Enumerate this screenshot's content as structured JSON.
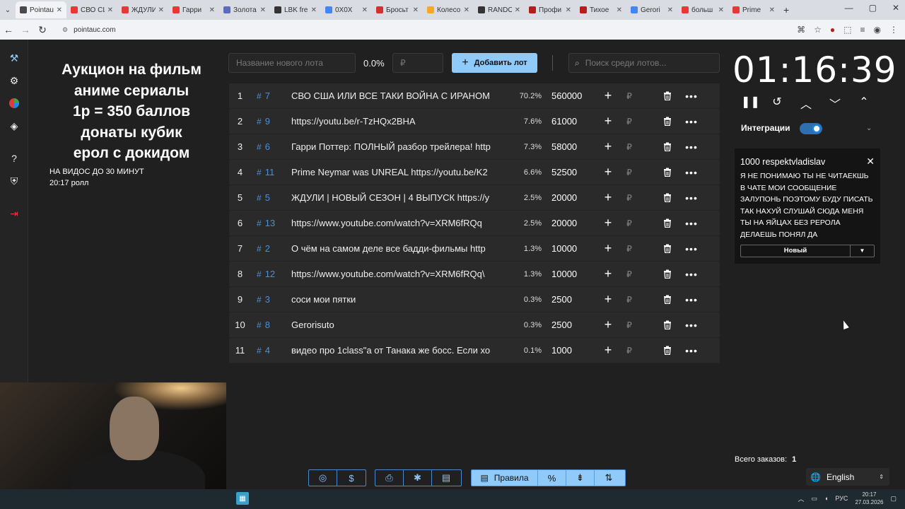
{
  "browser": {
    "tabs": [
      {
        "label": "Pointauc",
        "color": "#4a4a4a",
        "active": true
      },
      {
        "label": "СВО США",
        "color": "#e53935",
        "active": false
      },
      {
        "label": "ЖДУЛИ",
        "color": "#e53935",
        "active": false
      },
      {
        "label": "Гарри",
        "color": "#e53935",
        "active": false
      },
      {
        "label": "Золота",
        "color": "#5c6bc0",
        "active": false
      },
      {
        "label": "LBK fre",
        "color": "#333333",
        "active": false
      },
      {
        "label": "0Х0Х",
        "color": "#4285f4",
        "active": false
      },
      {
        "label": "Бросьт",
        "color": "#d32f2f",
        "active": false
      },
      {
        "label": "Колесо",
        "color": "#f9a825",
        "active": false
      },
      {
        "label": "RANDO",
        "color": "#333333",
        "active": false
      },
      {
        "label": "Профи",
        "color": "#b71c1c",
        "active": false
      },
      {
        "label": "Тихое",
        "color": "#b71c1c",
        "active": false
      },
      {
        "label": "Gerori",
        "color": "#4285f4",
        "active": false
      },
      {
        "label": "больш",
        "color": "#e53935",
        "active": false
      },
      {
        "label": "Prime",
        "color": "#e53935",
        "active": false
      }
    ],
    "url": "pointauc.com"
  },
  "sidebar": {
    "icons": [
      "hammer-icon",
      "gear-icon",
      "wheel-icon",
      "layers-icon",
      "help-icon",
      "shield-icon",
      "logout-icon"
    ]
  },
  "header": {
    "title_lines": [
      "Аукцион на фильм",
      "аниме сериалы",
      "1р = 350 баллов",
      "донаты кубик",
      "ерол с докидом"
    ],
    "note1": "НА ВИДОС ДО 30 МИНУТ",
    "note2": "20:17 ролл"
  },
  "controls": {
    "lot_name_placeholder": "Название нового лота",
    "percent": "0.0%",
    "amount_placeholder": "₽",
    "add_button": "Добавить лот",
    "search_placeholder": "Поиск среди лотов..."
  },
  "lots": [
    {
      "index": "1",
      "id": "7",
      "name": "СВО США ИЛИ ВСЕ ТАКИ ВОЙНА С ИРАНОМ",
      "percent": "70.2%",
      "amount": "560000"
    },
    {
      "index": "2",
      "id": "9",
      "name": "https://youtu.be/r-TzHQx2BHA",
      "percent": "7.6%",
      "amount": "61000"
    },
    {
      "index": "3",
      "id": "6",
      "name": "Гарри Поттер: ПОЛНЫЙ разбор трейлера! http",
      "percent": "7.3%",
      "amount": "58000"
    },
    {
      "index": "4",
      "id": "11",
      "name": "Prime Neymar was UNREAL https://youtu.be/K2",
      "percent": "6.6%",
      "amount": "52500"
    },
    {
      "index": "5",
      "id": "5",
      "name": "ЖДУЛИ | НОВЫЙ СЕЗОН | 4 ВЫПУСК https://y",
      "percent": "2.5%",
      "amount": "20000"
    },
    {
      "index": "6",
      "id": "13",
      "name": "https://www.youtube.com/watch?v=XRM6fRQq",
      "percent": "2.5%",
      "amount": "20000"
    },
    {
      "index": "7",
      "id": "2",
      "name": " О чём на самом деле все бадди-фильмы http",
      "percent": "1.3%",
      "amount": "10000"
    },
    {
      "index": "8",
      "id": "12",
      "name": "https://www.youtube.com/watch?v=XRM6fRQq\\",
      "percent": "1.3%",
      "amount": "10000"
    },
    {
      "index": "9",
      "id": "3",
      "name": "соси мои пятки",
      "percent": "0.3%",
      "amount": "2500"
    },
    {
      "index": "10",
      "id": "8",
      "name": "Gerorisuto",
      "percent": "0.3%",
      "amount": "2500"
    },
    {
      "index": "11",
      "id": "4",
      "name": "видео про 1class\"а от Танака же босс. Если хо",
      "percent": "0.1%",
      "amount": "1000"
    }
  ],
  "lot_currency": "₽",
  "timer": {
    "value": "01:16:39",
    "icons": [
      "pause-icon",
      "reset-icon",
      "chevron-up-icon",
      "chevron-down-icon",
      "double-chevron-up-icon"
    ]
  },
  "integrations": {
    "label": "Интеграции",
    "enabled": true
  },
  "donation": {
    "header": "1000 respektvladislav",
    "message": "Я НЕ ПОНИМАЮ ТЫ НЕ ЧИТАЕКШЬ В ЧАТЕ МОИ СООБЩЕНИЕ ЗАЛУПОНЬ ПОЭТОМУ БУДУ ПИСАТЬ ТАК НАХУЙ СЛУШАЙ СЮДА МЕНЯ ТЫ НА ЯЙЦАХ БЕЗ РЕРОЛА ДЕЛАЕШЬ ПОНЯЛ ДА",
    "select_value": "Новый"
  },
  "footer": {
    "orders_label": "Всего заказов:",
    "orders_count": "1",
    "language": "English",
    "rules_label": "Правила"
  },
  "taskbar": {
    "lang": "РУС",
    "time": "20:17",
    "date": "27.03.2026"
  }
}
